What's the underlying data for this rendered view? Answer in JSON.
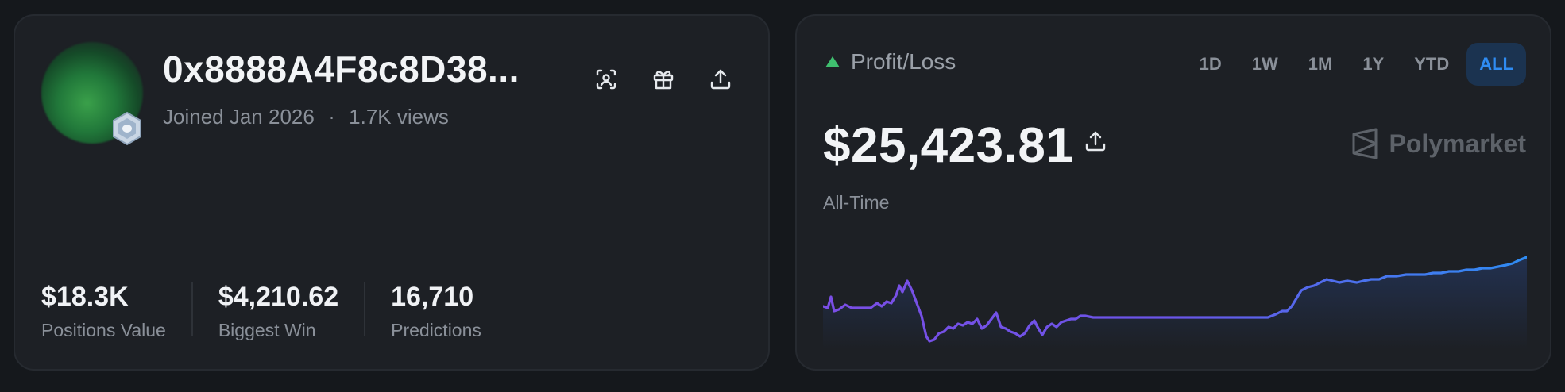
{
  "profile": {
    "username": "0x8888A4F8c8D38...",
    "joined": "Joined Jan 2026",
    "separator": "·",
    "views": "1.7K views",
    "actions": {
      "scan_icon": "scan-face-icon",
      "gift_icon": "gift-icon",
      "share_icon": "share-icon"
    },
    "stats": [
      {
        "value": "$18.3K",
        "label": "Positions Value"
      },
      {
        "value": "$4,210.62",
        "label": "Biggest Win"
      },
      {
        "value": "16,710",
        "label": "Predictions"
      }
    ]
  },
  "pnl": {
    "title": "Profit/Loss",
    "trend_color": "#3fbf6f",
    "ranges": [
      "1D",
      "1W",
      "1M",
      "1Y",
      "YTD",
      "ALL"
    ],
    "active_range": "ALL",
    "amount": "$25,423.81",
    "period_label": "All-Time",
    "brand": "Polymarket",
    "line_gradient": [
      "#7b4ee6",
      "#2f8cf3"
    ]
  }
}
